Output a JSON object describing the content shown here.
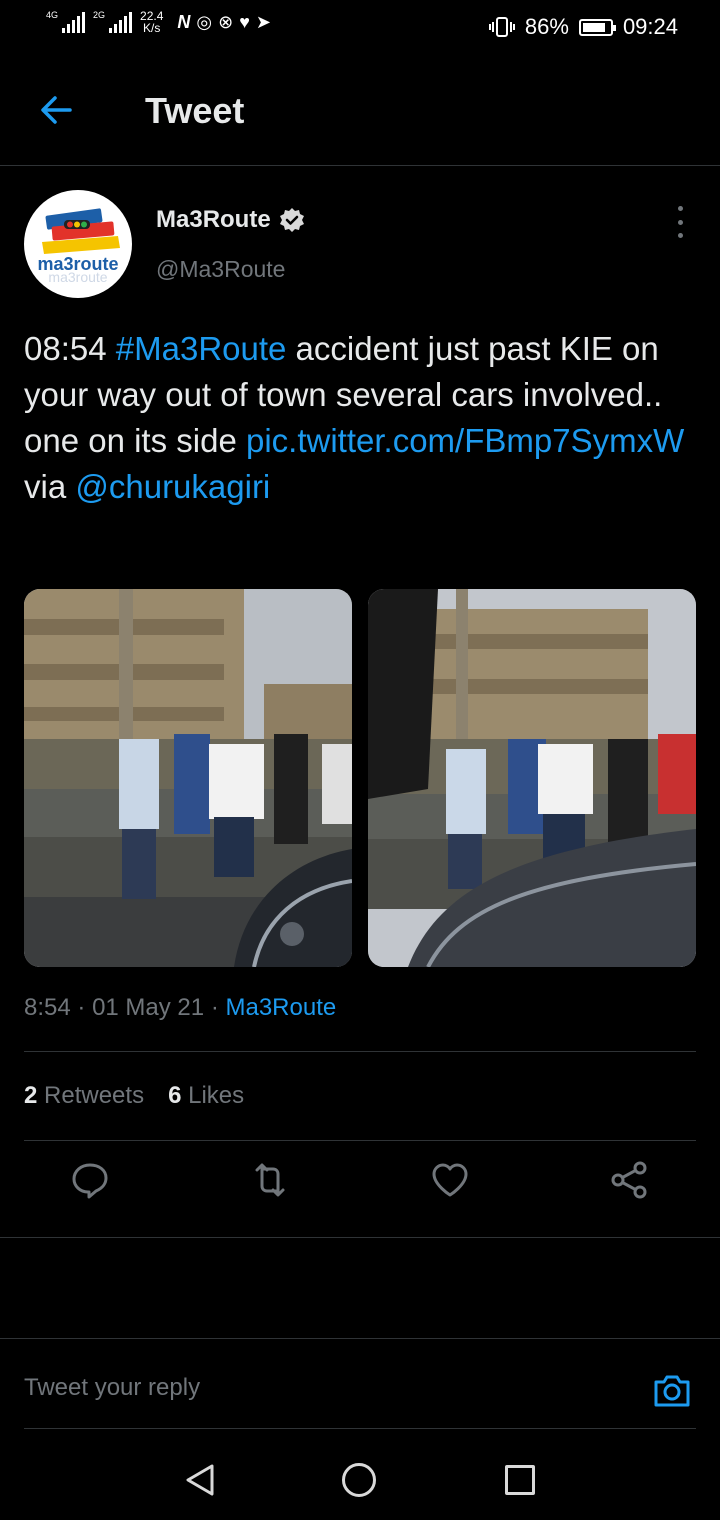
{
  "status_bar": {
    "sim1_label": "4G",
    "sim2_label": "2G",
    "speed_value": "22.4",
    "speed_unit": "K/s",
    "notification_icons": [
      "N",
      "◎",
      "⊗",
      "♥",
      "➤"
    ],
    "battery_percent_label": "86%",
    "battery_level": 0.86,
    "time": "09:24"
  },
  "header": {
    "title": "Tweet"
  },
  "tweet": {
    "author": {
      "name": "Ma3Route",
      "handle": "@Ma3Route",
      "verified": true,
      "avatar_text": "ma3route"
    },
    "text": {
      "time": "08:54",
      "hashtag": "#Ma3Route",
      "body": " accident just past KIE on your way out of town several cars involved.. one on its side ",
      "link": "pic.twitter.com/FBmp7SymxW",
      "via": " via ",
      "mention": "@churukagiri"
    },
    "meta": {
      "time": "8:54",
      "date": "01 May 21",
      "source": "Ma3Route"
    },
    "stats": {
      "retweets_count": "2",
      "retweets_label": "Retweets",
      "likes_count": "6",
      "likes_label": "Likes"
    }
  },
  "reply": {
    "placeholder": "Tweet your reply"
  },
  "colors": {
    "background": "#000000",
    "accent": "#1d9bf0",
    "text_primary": "#e7e9ea",
    "text_secondary": "#71767b",
    "divider": "#2f3336"
  }
}
